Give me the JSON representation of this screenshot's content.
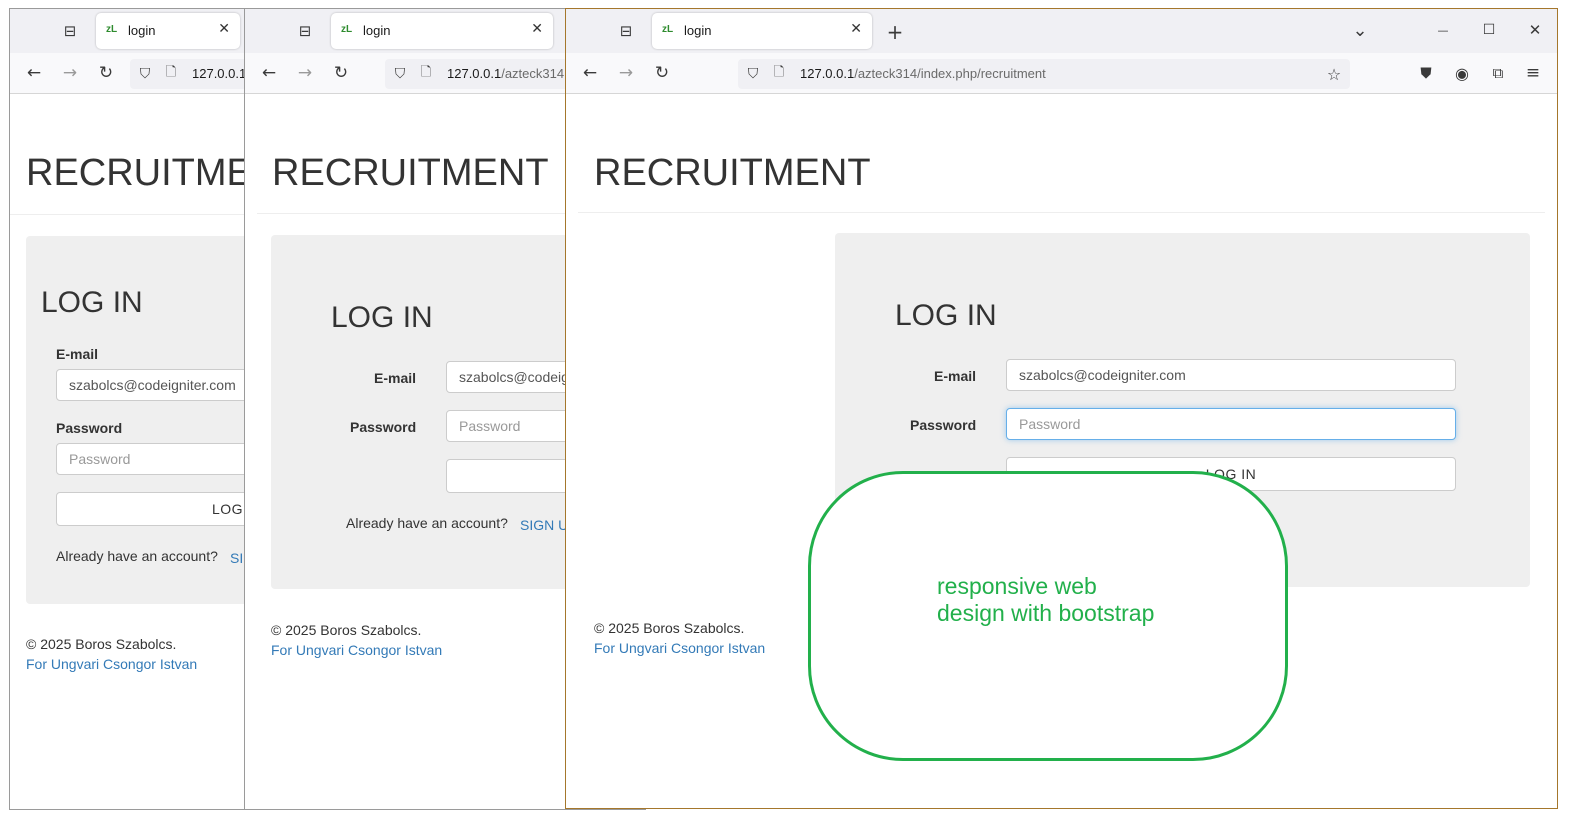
{
  "browser": {
    "tab_favicon": "zL",
    "tab_title": "login",
    "url_host": "127.0.0.1",
    "url_path": "/azteck314/index.php/recruitment",
    "url_w1": "127.0.0.1,",
    "url_w2_host": "127.0.0.1",
    "url_w2_path": "/azteck314",
    "icons": {
      "back": "←",
      "forward": "→",
      "reload": "↻",
      "shield": "⛉",
      "page": "🗋",
      "star": "☆",
      "close_tab": "✕",
      "new_tab": "+",
      "tab_list": "⌄",
      "minimize": "—",
      "maximize": "☐",
      "close_window": "✕",
      "menu": "≡",
      "pocket": "⛊",
      "account": "◉",
      "extensions": "⧉",
      "tab_groups": "⊟"
    }
  },
  "page": {
    "heading": "RECRUITMENT",
    "heading_w1": "RECRUITMEN",
    "form_title": "LOG IN",
    "email_label": "E-mail",
    "email_value": "szabolcs@codeigniter.com",
    "email_value_w1": "szabolcs@codeigniter.com",
    "email_value_w2": "szabolcs@codeig",
    "password_label": "Password",
    "password_placeholder": "Password",
    "login_button": "LOG IN",
    "login_button_w1": "LOG",
    "login_button_w3": "LOG IN",
    "account_prompt": "Already have an account?",
    "signup_link": "SIGN UP",
    "signup_link_w1": "SI",
    "signup_link_w2": "SIGN U",
    "copyright": "© 2025 Boros Szabolcs.",
    "credit_link": "For Ungvari Csongor Istvan"
  },
  "annotation": {
    "line1": "responsive web",
    "line2": "design with bootstrap",
    "color": "#22b04b"
  }
}
